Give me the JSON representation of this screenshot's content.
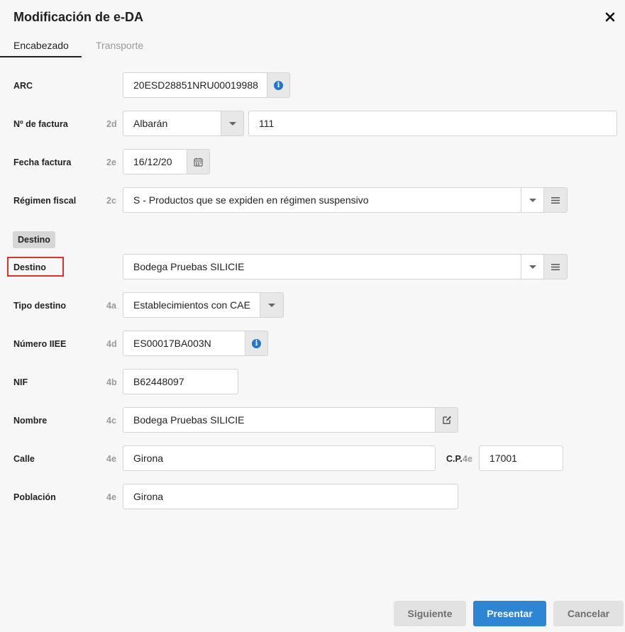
{
  "dialog": {
    "title": "Modificación de e-DA"
  },
  "tabs": [
    {
      "label": "Encabezado",
      "active": true
    },
    {
      "label": "Transporte",
      "active": false
    }
  ],
  "fields": {
    "arc": {
      "label": "ARC",
      "code": "",
      "value": "20ESD28851NRU00019988"
    },
    "factura": {
      "label": "Nº de factura",
      "code": "2d",
      "type_value": "Albarán",
      "number_value": "111"
    },
    "fecha": {
      "label": "Fecha factura",
      "code": "2e",
      "value": "16/12/20"
    },
    "regimen": {
      "label": "Régimen fiscal",
      "code": "2c",
      "value": "S - Productos que se expiden en régimen suspensivo"
    },
    "section_destino": {
      "label": "Destino"
    },
    "destino": {
      "label": "Destino",
      "code": "",
      "value": "Bodega Pruebas SILICIE"
    },
    "tipo_destino": {
      "label": "Tipo destino",
      "code": "4a",
      "value": "Establecimientos con CAE"
    },
    "numero_iiee": {
      "label": "Número IIEE",
      "code": "4d",
      "value": "ES00017BA003N"
    },
    "nif": {
      "label": "NIF",
      "code": "4b",
      "value": "B62448097"
    },
    "nombre": {
      "label": "Nombre",
      "code": "4c",
      "value": "Bodega Pruebas SILICIE"
    },
    "calle": {
      "label": "Calle",
      "code": "4e",
      "value": "Girona"
    },
    "cp": {
      "label": "C.P.",
      "code": "4e",
      "value": "17001"
    },
    "poblacion": {
      "label": "Población",
      "code": "4e",
      "value": "Girona"
    }
  },
  "footer": {
    "next_label": "Siguiente",
    "submit_label": "Presentar",
    "cancel_label": "Cancelar"
  },
  "colors": {
    "primary": "#2d85d3",
    "highlight": "#d9322f",
    "info": "#2277cc"
  },
  "icons": {
    "close": "close-icon",
    "info": "info-icon",
    "calendar": "calendar-icon",
    "caret": "chevron-down-icon",
    "list": "list-icon",
    "edit": "edit-icon"
  }
}
